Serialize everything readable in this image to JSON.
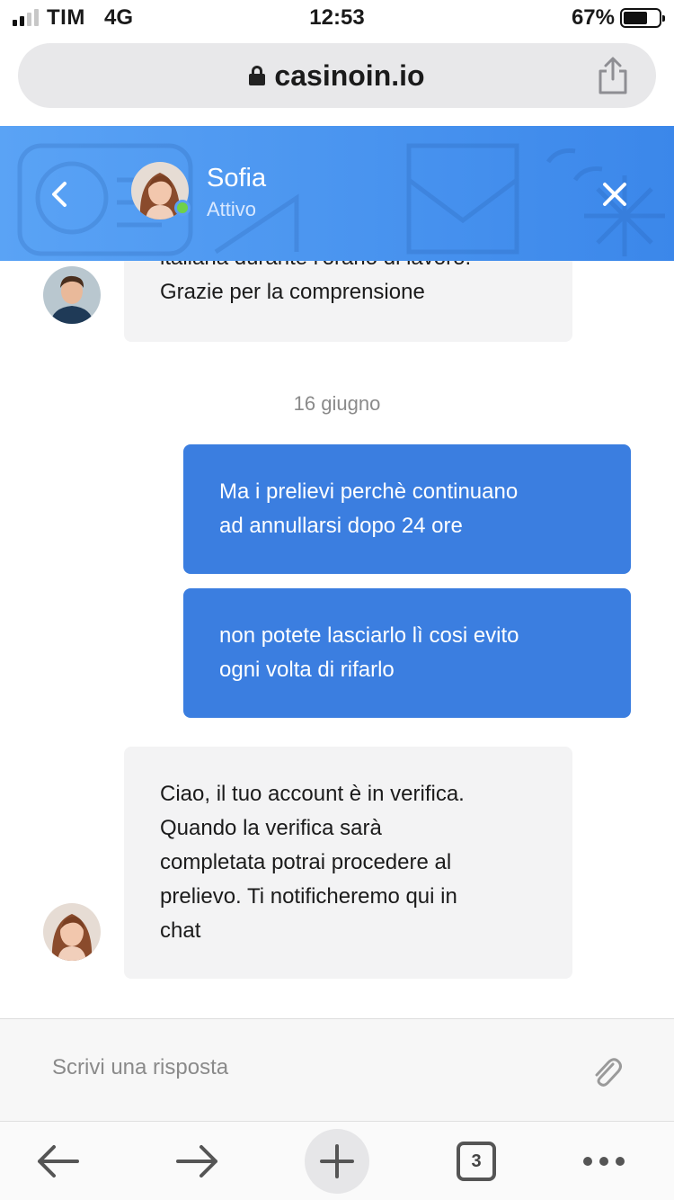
{
  "status_bar": {
    "carrier": "TIM",
    "network": "4G",
    "time": "12:53",
    "battery_percent": "67%"
  },
  "browser": {
    "url": "casinoin.io",
    "tabs_count": "3"
  },
  "chat": {
    "agent_name": "Sofia",
    "agent_status": "Attivo",
    "header_color": "#4a95ee",
    "online_color": "#6fd14a",
    "messages": [
      {
        "from": "agent",
        "lines": [
          "italiana durante l'orario di lavoro.",
          "Grazie per la comprensione"
        ]
      },
      {
        "from": "user",
        "lines": [
          "Ma i prelievi perchè continuano",
          "ad annullarsi dopo 24 ore"
        ]
      },
      {
        "from": "user",
        "lines": [
          "non potete lasciarlo lì cosi evito",
          "ogni volta di rifarlo"
        ]
      },
      {
        "from": "agent",
        "lines": [
          "Ciao, il tuo account è in verifica.",
          "Quando la verifica sarà",
          "completata potrai procedere al",
          "prelievo. Ti notificheremo qui in",
          "chat"
        ]
      }
    ],
    "date_separator": "16 giugno",
    "user_bubble_color": "#3b7ee0",
    "agent_bubble_color": "#f3f3f4"
  },
  "composer": {
    "placeholder": "Scrivi una risposta"
  },
  "icons": {
    "back": "chevron-left-icon",
    "close": "close-icon",
    "attach": "paperclip-icon",
    "lock": "lock-icon",
    "share": "share-icon",
    "nav_back": "arrow-left-icon",
    "nav_forward": "arrow-right-icon",
    "new_tab": "plus-icon",
    "more": "more-dots-icon"
  }
}
